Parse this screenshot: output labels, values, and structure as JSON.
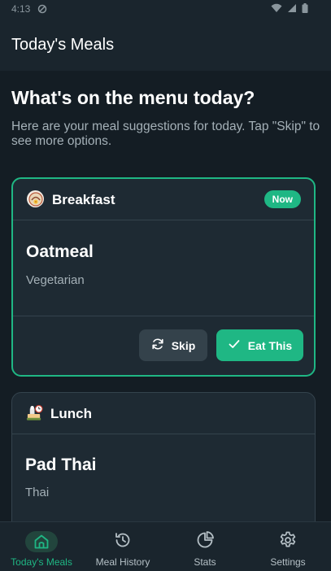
{
  "status_bar": {
    "time": "4:13"
  },
  "app_bar": {
    "title": "Today's Meals"
  },
  "intro": {
    "heading": "What's on the menu today?",
    "subheading": "Here are your meal suggestions for today. Tap \"Skip\" to see more options."
  },
  "meals": [
    {
      "type": "Breakfast",
      "badge": "Now",
      "name": "Oatmeal",
      "tag": "Vegetarian",
      "icon": "breakfast-icon",
      "skip_label": "Skip",
      "eat_label": "Eat This"
    },
    {
      "type": "Lunch",
      "name": "Pad Thai",
      "tag": "Thai",
      "icon": "lunch-icon"
    }
  ],
  "bottom_nav": {
    "items": [
      {
        "label": "Today's Meals",
        "icon": "home-icon",
        "selected": true
      },
      {
        "label": "Meal History",
        "icon": "history-icon",
        "selected": false
      },
      {
        "label": "Stats",
        "icon": "pie-chart-icon",
        "selected": false
      },
      {
        "label": "Settings",
        "icon": "gear-icon",
        "selected": false
      }
    ]
  },
  "colors": {
    "accent": "#1fb784",
    "background": "#141d24",
    "card": "#1e2a33",
    "muted_text": "#a4b0b7"
  }
}
